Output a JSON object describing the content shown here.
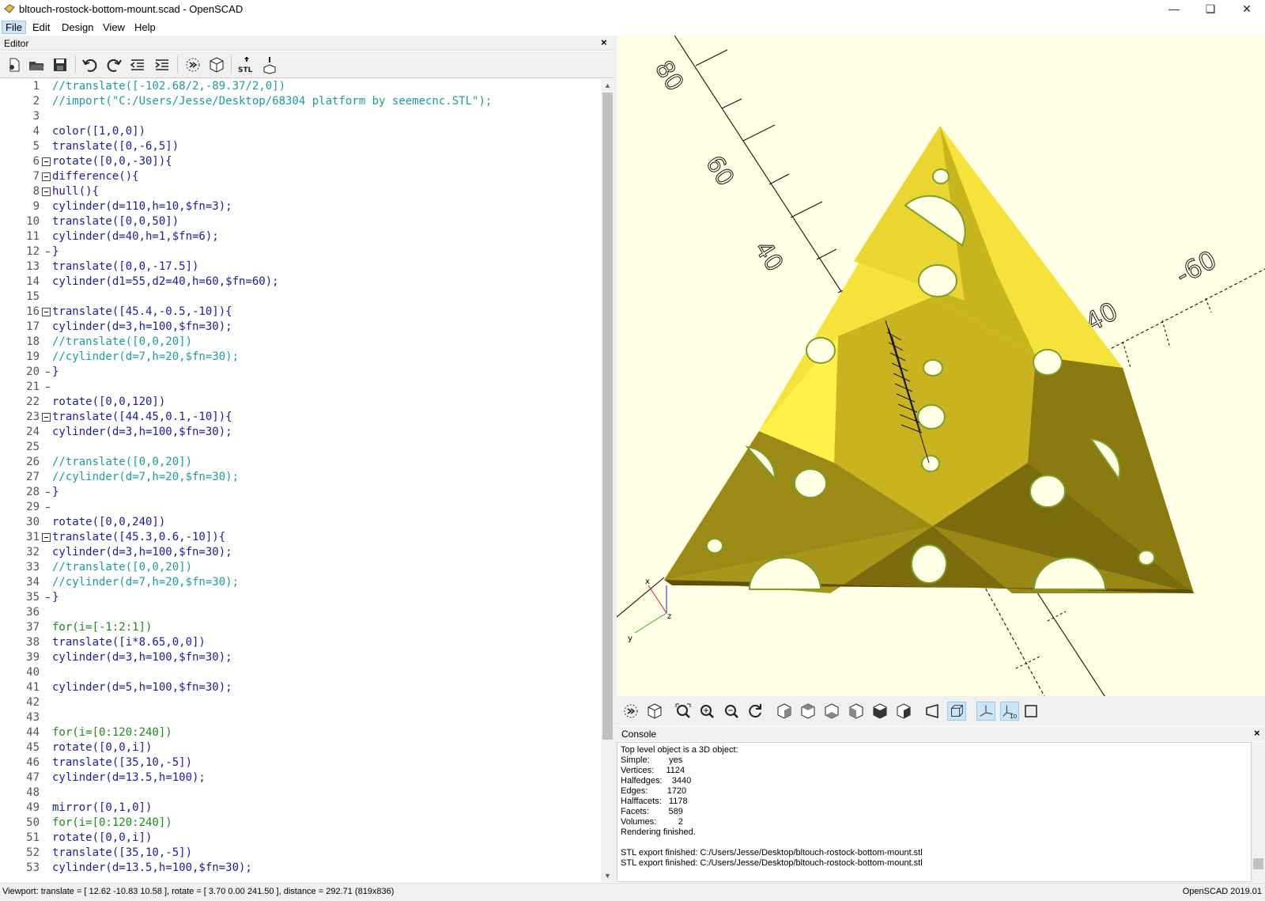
{
  "window": {
    "title": "bltouch-rostock-bottom-mount.scad - OpenSCAD"
  },
  "menu": [
    "File",
    "Edit",
    "Design",
    "View",
    "Help"
  ],
  "editor": {
    "title": "Editor",
    "toolbar_icons": [
      "new-file-icon",
      "open-file-icon",
      "save-icon",
      "undo-icon",
      "redo-icon",
      "unindent-icon",
      "indent-icon",
      "preview-icon",
      "render-icon",
      "export-stl-icon",
      "send-to-print-icon"
    ],
    "lines": [
      "//translate([-102.68/2,-89.37/2,0])",
      "//import(\"C:/Users/Jesse/Desktop/68304 platform by seemecnc.STL\");",
      "",
      "color([1,0,0])",
      "translate([0,-6,5])",
      "rotate([0,0,-30]){",
      "difference(){",
      "hull(){",
      "cylinder(d=110,h=10,$fn=3);",
      "translate([0,0,50])",
      "cylinder(d=40,h=1,$fn=6);",
      "}",
      "translate([0,0,-17.5])",
      "cylinder(d1=55,d2=40,h=60,$fn=60);",
      "",
      "translate([45.4,-0.5,-10]){",
      "cylinder(d=3,h=100,$fn=30);",
      "//translate([0,0,20])",
      "//cylinder(d=7,h=20,$fn=30);",
      "}",
      "",
      "rotate([0,0,120])",
      "translate([44.45,0.1,-10]){",
      "cylinder(d=3,h=100,$fn=30);",
      "",
      "//translate([0,0,20])",
      "//cylinder(d=7,h=20,$fn=30);",
      "}",
      "",
      "rotate([0,0,240])",
      "translate([45.3,0.6,-10]){",
      "cylinder(d=3,h=100,$fn=30);",
      "//translate([0,0,20])",
      "//cylinder(d=7,h=20,$fn=30);",
      "}",
      "",
      "for(i=[-1:2:1])",
      "translate([i*8.65,0,0])",
      "cylinder(d=3,h=100,$fn=30);",
      "",
      "cylinder(d=5,h=100,$fn=30);",
      "",
      "",
      "for(i=[0:120:240])",
      "rotate([0,0,i])",
      "translate([35,10,-5])",
      "cylinder(d=13.5,h=100);",
      "",
      "mirror([0,1,0])",
      "for(i=[0:120:240])",
      "rotate([0,0,i])",
      "translate([35,10,-5])",
      "cylinder(d=13.5,h=100,$fn=30);"
    ]
  },
  "viewport": {
    "axis_labels": [
      "80",
      "60",
      "40",
      "-40",
      "-60"
    ],
    "axis_gizmo": {
      "x": "x",
      "y": "y",
      "z": "z"
    },
    "model_color": "#f5e33c",
    "background_color": "#ffffe5"
  },
  "view_toolbar_icons": [
    "preview-icon",
    "render-icon",
    "view-all-icon",
    "zoom-in-icon",
    "zoom-out-icon",
    "reset-view-icon",
    "view-right-icon",
    "view-top-icon",
    "view-bottom-icon",
    "view-left-icon",
    "view-front-icon",
    "view-back-icon",
    "perspective-icon",
    "orthogonal-icon",
    "show-axes-icon",
    "show-scale-markers-icon",
    "show-edges-icon"
  ],
  "console": {
    "title": "Console",
    "lines": [
      "Top level object is a 3D object:",
      "Simple:        yes",
      "Vertices:     1124",
      "Halfedges:    3440",
      "Edges:        1720",
      "Halffacets:   1178",
      "Facets:        589",
      "Volumes:         2",
      "Rendering finished.",
      "",
      "STL export finished: C:/Users/Jesse/Desktop/bltouch-rostock-bottom-mount.stl",
      "STL export finished: C:/Users/Jesse/Desktop/bltouch-rostock-bottom-mount.stl"
    ]
  },
  "status": {
    "viewport": "Viewport: translate = [ 12.62 -10.83 10.58 ], rotate = [ 3.70 0.00 241.50 ], distance = 292.71 (819x836)",
    "version": "OpenSCAD 2019.01"
  }
}
